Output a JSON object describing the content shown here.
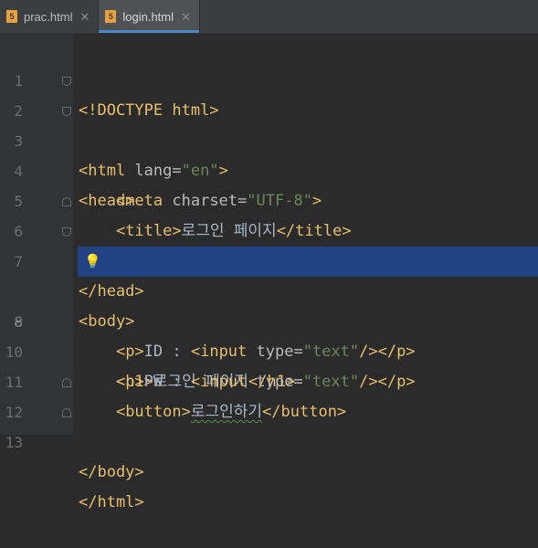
{
  "tabs": [
    {
      "label": "prac.html",
      "icon": "html-file-icon",
      "active": false
    },
    {
      "label": "login.html",
      "icon": "html-file-icon",
      "active": true
    }
  ],
  "editor": {
    "current_line": 8,
    "lines": [
      {
        "n": "1",
        "open": "<!DOCTYPE",
        "rest": " html>"
      },
      {
        "n": "2",
        "open": "<html",
        "attr": " lang=",
        "val": "\"en\"",
        "close": ">"
      },
      {
        "n": "3",
        "open": "<head>"
      },
      {
        "n": "4",
        "indent": "    ",
        "open": "<meta",
        "attr": " charset=",
        "val": "\"UTF-8\"",
        "close": ">"
      },
      {
        "n": "5",
        "indent": "    ",
        "open": "<title>",
        "text": "로그인 페이지",
        "close": "</title>"
      },
      {
        "n": "6",
        "open": "</head>"
      },
      {
        "n": "7",
        "open": "<body>"
      },
      {
        "n": "8",
        "indent": "    ",
        "open": "<h1>",
        "text": "로그인 페이지",
        "close": "</h1>"
      },
      {
        "n": "9",
        "indent": "    ",
        "open": "<p>",
        "text": "ID : ",
        "open2": "<input",
        "attr": " type=",
        "val": "\"text\"",
        "close": "/></p>"
      },
      {
        "n": "10",
        "indent": "    ",
        "open": "<p>",
        "text": "PW : ",
        "open2": "<input",
        "attr": " type=",
        "val": "\"text\"",
        "close": "/></p>"
      },
      {
        "n": "11",
        "indent": "    ",
        "open": "<button>",
        "text": "로그인하기",
        "close": "</button>"
      },
      {
        "n": "12",
        "open": "</body>"
      },
      {
        "n": "13",
        "open": "</html>"
      }
    ]
  },
  "colors": {
    "tag": "#e8bf6a",
    "attribute": "#bababa",
    "value": "#6a8759",
    "text": "#a9b7c6",
    "current_line_bg": "#214283",
    "tab_underline": "#4a88c7"
  }
}
